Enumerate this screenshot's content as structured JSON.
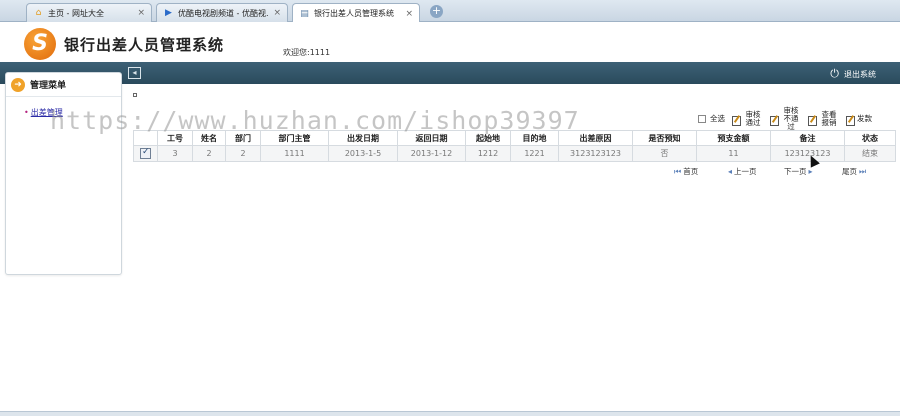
{
  "browser": {
    "tabs": [
      {
        "label": "主页 - 网址大全",
        "icon": "home-icon"
      },
      {
        "label": "优酷电视剧频道 - 优酷视...",
        "icon": "play-icon"
      },
      {
        "label": "银行出差人员管理系统",
        "icon": "page-icon"
      }
    ],
    "close_glyph": "×",
    "new_tab_glyph": "+"
  },
  "header": {
    "logo_letter": "S",
    "title": "银行出差人员管理系统",
    "welcome": "欢迎您:1111"
  },
  "navbar": {
    "collapse_glyph": "◂",
    "logout_label": "退出系统"
  },
  "sidebar": {
    "title": "管理菜单",
    "items": [
      {
        "label": "出差管理"
      }
    ]
  },
  "toolbar": {
    "select_all": "全选",
    "approve": "审核通过",
    "reject": "审核不通过",
    "view_reimburse": "查看报销",
    "send": "发款"
  },
  "table": {
    "columns": [
      "工号",
      "姓名",
      "部门",
      "部门主管",
      "出发日期",
      "返回日期",
      "起始地",
      "目的地",
      "出差原因",
      "是否预知",
      "预支金额",
      "备注",
      "状态"
    ],
    "rows": [
      [
        "3",
        "2",
        "2",
        "1111",
        "2013-1-5",
        "2013-1-12",
        "1212",
        "1221",
        "3123123123",
        "否",
        "11",
        "123123123",
        "结束"
      ]
    ]
  },
  "pager": {
    "first": "首页",
    "prev": "上一页",
    "next": "下一页",
    "last": "尾页"
  },
  "watermark": "https://www.huzhan.com/ishop39397",
  "colors": {
    "navbar": "#2f5062",
    "accent_orange": "#f0a229",
    "link": "#2a2aa6"
  }
}
